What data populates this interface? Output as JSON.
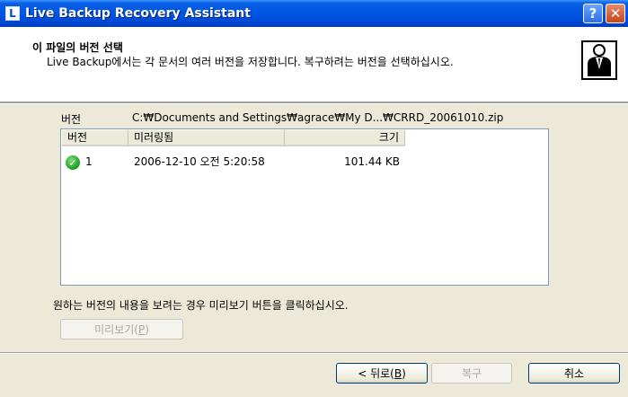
{
  "window": {
    "title": "Live Backup Recovery Assistant",
    "icon_letter": "L",
    "help_glyph": "?",
    "close_glyph": "✕"
  },
  "header": {
    "title": "이 파일의 버전 선택",
    "description": "Live Backup에서는 각 문서의 여러 버전을 저장합니다. 복구하려는 버전을 선택하십시오."
  },
  "version": {
    "label": "버전",
    "path": "C:₩Documents and Settings₩agrace₩My D...₩CRRD_20061010.zip"
  },
  "list": {
    "columns": [
      "버전",
      "미러링됨",
      "크기"
    ],
    "rows": [
      {
        "version": "1",
        "mirrored": "2006-12-10 오전 5:20:58",
        "size": "101.44 KB",
        "status_icon": "check-icon"
      }
    ]
  },
  "hint": "원하는 버전의 내용을 보려는 경우 미리보기 버튼을 클릭하십시오.",
  "buttons": {
    "preview_main": "미리보기(",
    "preview_key": "P",
    "preview_end": ")",
    "back_prefix": "< 뒤로(",
    "back_key": "B",
    "back_end": ")",
    "restore": "복구",
    "cancel": "취소"
  }
}
